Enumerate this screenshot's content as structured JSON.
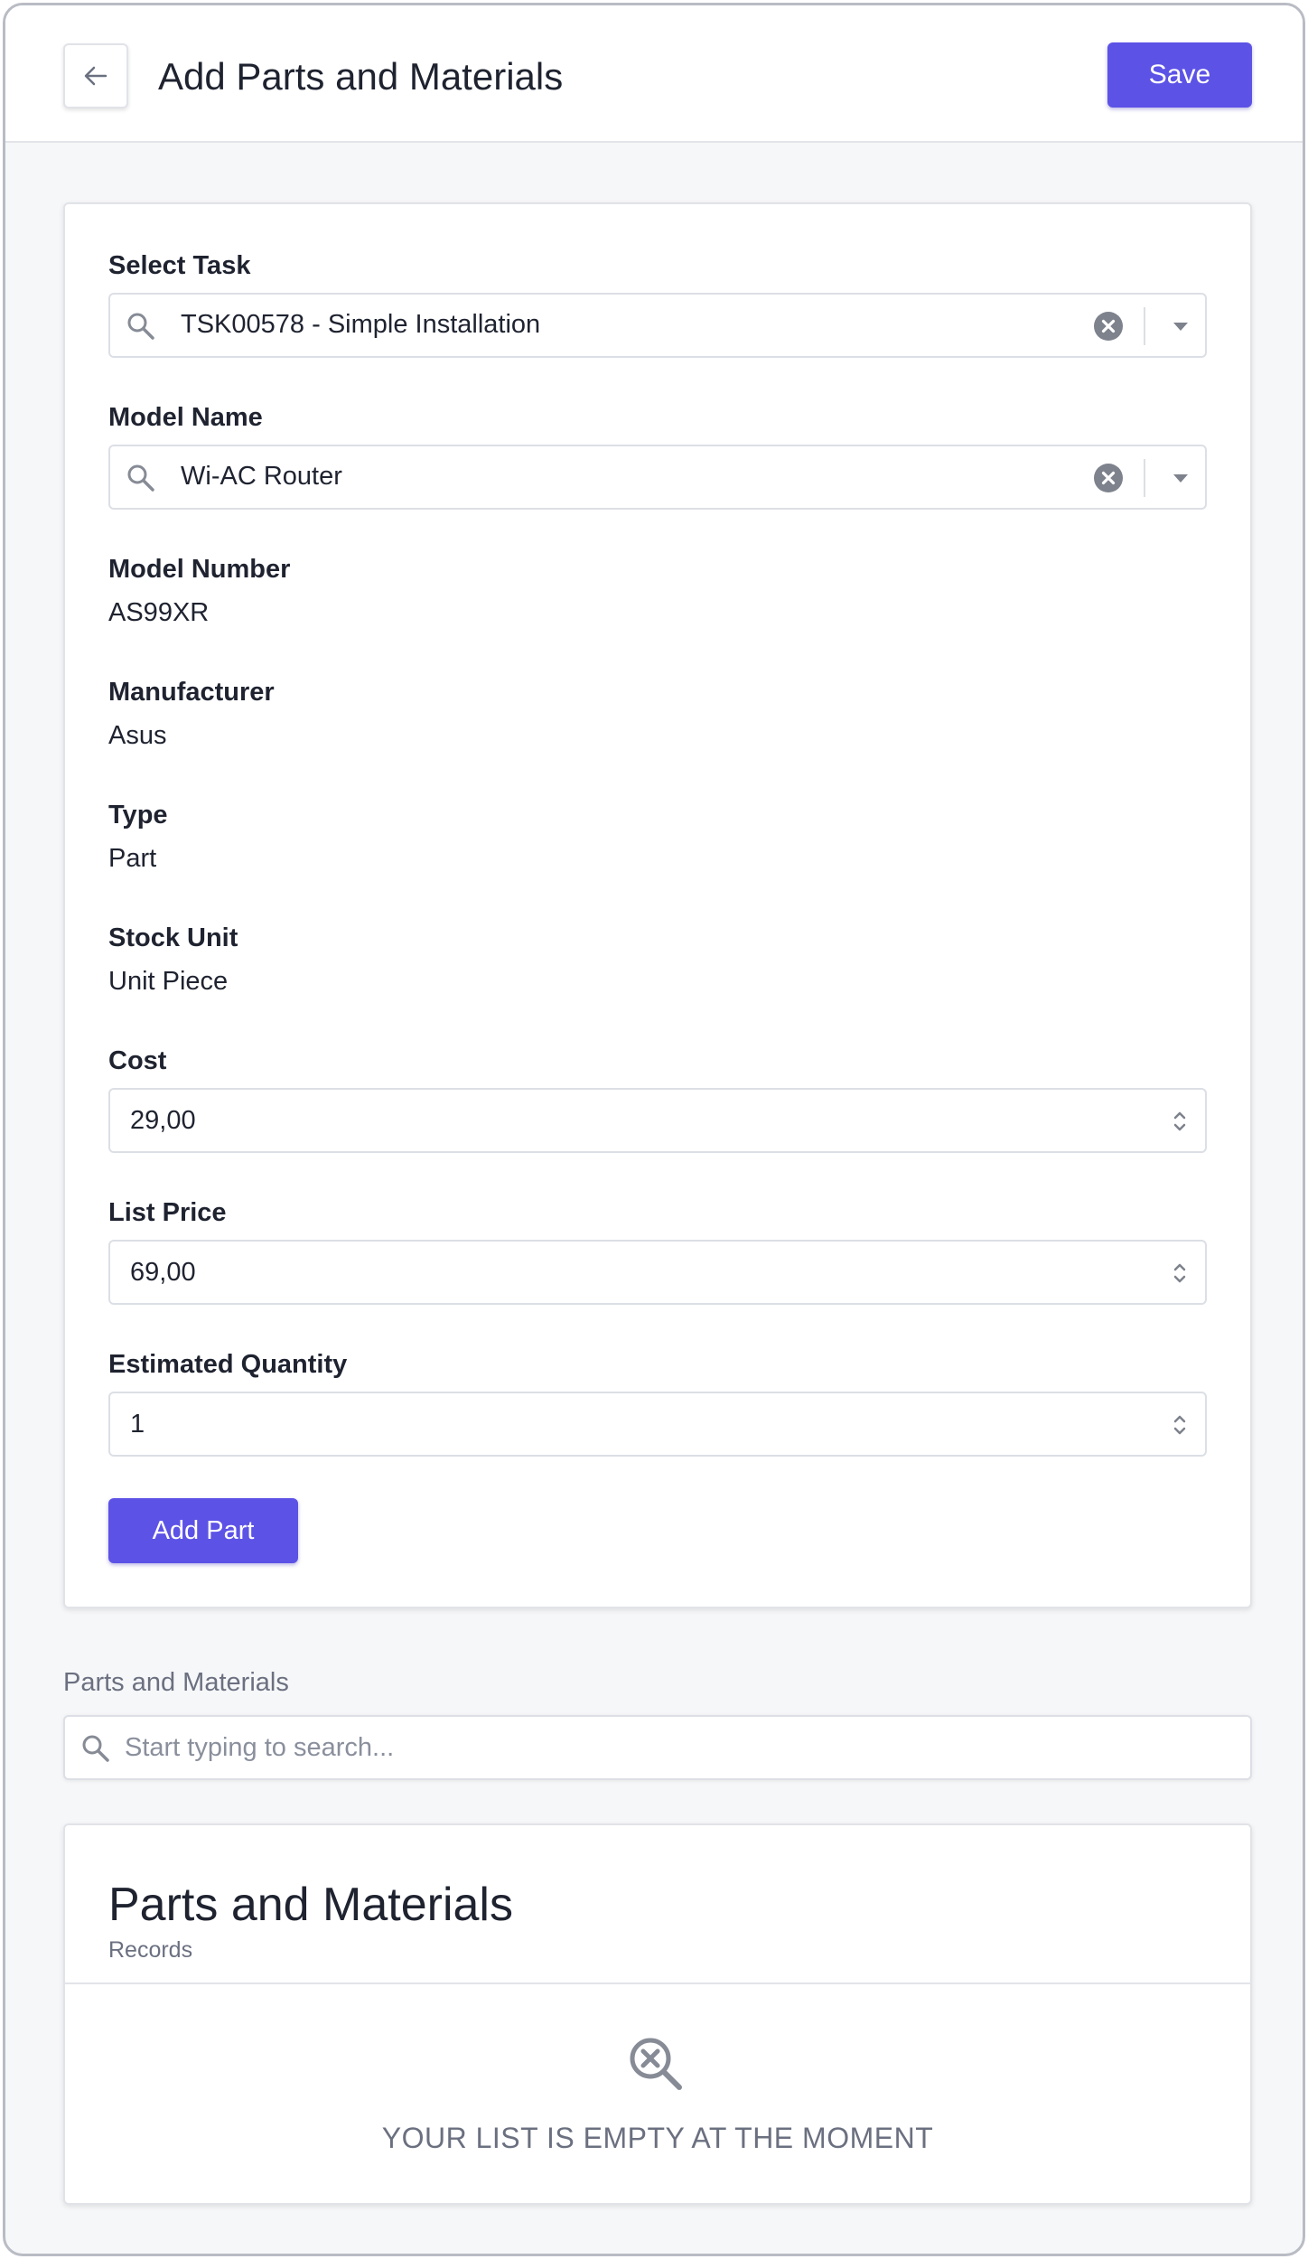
{
  "header": {
    "title": "Add Parts and Materials",
    "save_label": "Save"
  },
  "form": {
    "select_task": {
      "label": "Select Task",
      "value": "TSK00578 - Simple Installation"
    },
    "model_name": {
      "label": "Model Name",
      "value": "Wi-AC Router"
    },
    "model_number": {
      "label": "Model Number",
      "value": "AS99XR"
    },
    "manufacturer": {
      "label": "Manufacturer",
      "value": "Asus"
    },
    "type": {
      "label": "Type",
      "value": "Part"
    },
    "stock_unit": {
      "label": "Stock Unit",
      "value": "Unit Piece"
    },
    "cost": {
      "label": "Cost",
      "value": "29,00"
    },
    "list_price": {
      "label": "List Price",
      "value": "69,00"
    },
    "estimated_quantity": {
      "label": "Estimated Quantity",
      "value": "1"
    },
    "add_part_label": "Add Part"
  },
  "parts_section": {
    "label": "Parts and Materials",
    "search_placeholder": "Start typing to search..."
  },
  "list": {
    "title": "Parts and Materials",
    "subtitle": "Records",
    "empty_message": "YOUR LIST IS EMPTY AT THE MOMENT"
  },
  "colors": {
    "accent": "#5c52e6",
    "background": "#f6f7f9",
    "muted_text": "#6b7080",
    "icon_gray": "#868b95"
  },
  "icons": {
    "back": "arrow-left-icon",
    "search": "magnifier-icon",
    "clear": "x-circle-icon",
    "caret": "caret-down-icon",
    "spinner": "chevron-up-down-icon",
    "empty": "search-x-icon"
  }
}
